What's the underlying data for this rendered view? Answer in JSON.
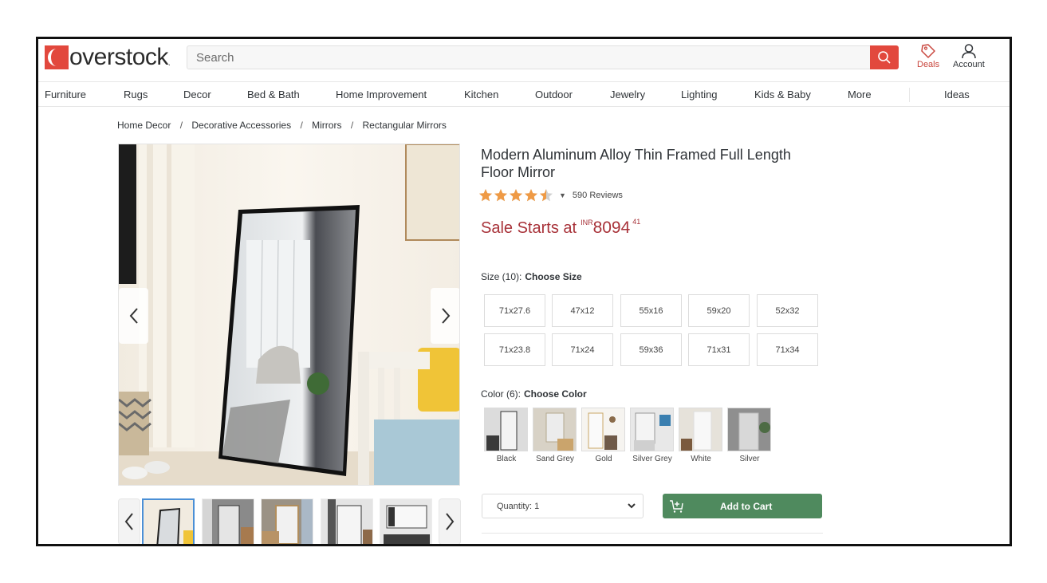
{
  "header": {
    "logo_text": "overstock",
    "logo_suffix": ".",
    "search_placeholder": "Search",
    "search_value": "",
    "deals_label": "Deals",
    "account_label": "Account"
  },
  "nav": {
    "items": [
      {
        "label": "Furniture"
      },
      {
        "label": "Rugs"
      },
      {
        "label": "Decor"
      },
      {
        "label": "Bed & Bath"
      },
      {
        "label": "Home Improvement"
      },
      {
        "label": "Kitchen"
      },
      {
        "label": "Outdoor"
      },
      {
        "label": "Jewelry"
      },
      {
        "label": "Lighting"
      },
      {
        "label": "Kids & Baby"
      },
      {
        "label": "More"
      },
      {
        "label": "Ideas"
      }
    ]
  },
  "breadcrumb": {
    "items": [
      "Home Decor",
      "Decorative Accessories",
      "Mirrors",
      "Rectangular Mirrors"
    ],
    "separator": "/"
  },
  "gallery": {
    "prev_label": "‹",
    "next_label": "›",
    "thumbnail_count": 5,
    "active_thumbnail": 0
  },
  "product": {
    "title": "Modern Aluminum Alloy Thin Framed Full Length Floor Mirror",
    "rating": 4.5,
    "rating_max": 5,
    "reviews_label": "590 Reviews",
    "price": {
      "lead": "Sale Starts at",
      "currency": "INR",
      "whole": "8094",
      "cents": "41"
    },
    "size": {
      "label": "Size (10):",
      "prompt": "Choose Size",
      "options": [
        "71x27.6",
        "47x12",
        "55x16",
        "59x20",
        "52x32",
        "71x23.8",
        "71x24",
        "59x36",
        "71x31",
        "71x34"
      ]
    },
    "color": {
      "label": "Color (6):",
      "prompt": "Choose Color",
      "options": [
        "Black",
        "Sand Grey",
        "Gold",
        "Silver Grey",
        "White",
        "Silver"
      ]
    },
    "quantity_label": "Quantity: 1",
    "add_to_cart_label": "Add to Cart"
  },
  "colors": {
    "brand_red": "#e2483d",
    "price_red": "#a83239",
    "star_orange": "#ef9a45",
    "cart_green": "#4f8a5e",
    "active_thumb_blue": "#4a8fd6"
  }
}
